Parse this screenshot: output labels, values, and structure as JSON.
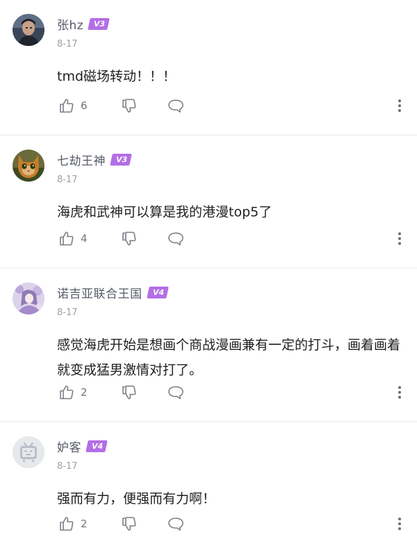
{
  "comments": [
    {
      "username": "张hz",
      "level": "V3",
      "date": "8-17",
      "content": "tmd磁场转动！！！",
      "likes": "6",
      "avatar": "avatar-dark-man"
    },
    {
      "username": "七劫王神",
      "level": "V3",
      "date": "8-17",
      "content": "海虎和武神可以算是我的港漫top5了",
      "likes": "4",
      "avatar": "avatar-cat"
    },
    {
      "username": "诺吉亚联合王国",
      "level": "V4",
      "date": "8-17",
      "content": "感觉海虎开始是想画个商战漫画兼有一定的打斗，画着画着就变成猛男激情对打了。",
      "likes": "2",
      "avatar": "avatar-anime-girl"
    },
    {
      "username": "妒客",
      "level": "V4",
      "date": "8-17",
      "content": "强而有力，便强而有力啊！",
      "likes": "2",
      "avatar": "avatar-default-tv"
    }
  ],
  "icons": {
    "like": "thumb-up-icon",
    "dislike": "thumb-down-icon",
    "reply": "reply-bubble-icon",
    "more": "more-vertical-icon"
  },
  "colors": {
    "badge": "#b36ee6",
    "divider": "#f2f2f2",
    "text": "#1f1f1f",
    "meta": "#9aa0a6",
    "icon": "#7a7f86"
  }
}
